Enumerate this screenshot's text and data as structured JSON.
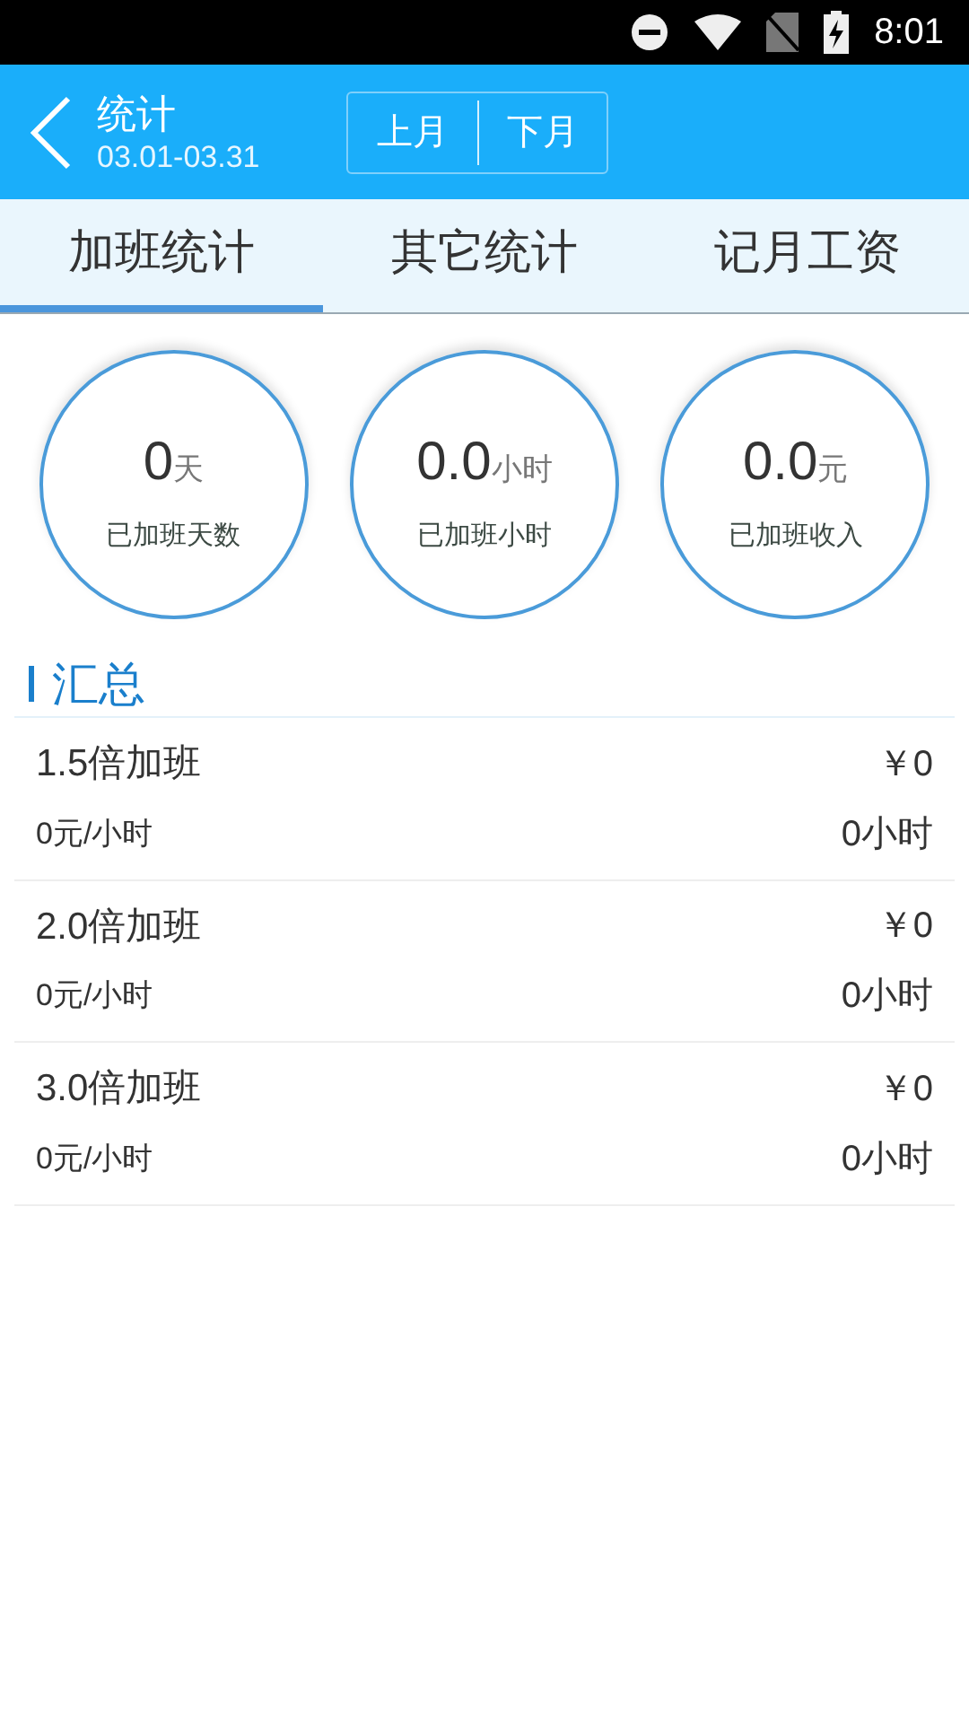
{
  "status_bar": {
    "time": "8:01"
  },
  "header": {
    "title": "统计",
    "date_range": "03.01-03.31",
    "month_buttons": [
      "上月",
      "下月"
    ]
  },
  "tabs": [
    {
      "label": "加班统计",
      "selected": true
    },
    {
      "label": "其它统计",
      "selected": false
    },
    {
      "label": "记月工资",
      "selected": false
    }
  ],
  "stats": [
    {
      "value": "0",
      "unit": "天",
      "label": "已加班天数"
    },
    {
      "value": "0.0",
      "unit": "小时",
      "label": "已加班小时"
    },
    {
      "value": "0.0",
      "unit": "元",
      "label": "已加班收入"
    }
  ],
  "summary": {
    "title": "汇总",
    "rows": [
      {
        "name": "1.5倍加班",
        "amount": "￥0",
        "rate": "0元/小时",
        "hours": "0小时"
      },
      {
        "name": "2.0倍加班",
        "amount": "￥0",
        "rate": "0元/小时",
        "hours": "0小时"
      },
      {
        "name": "3.0倍加班",
        "amount": "￥0",
        "rate": "0元/小时",
        "hours": "0小时"
      }
    ]
  }
}
